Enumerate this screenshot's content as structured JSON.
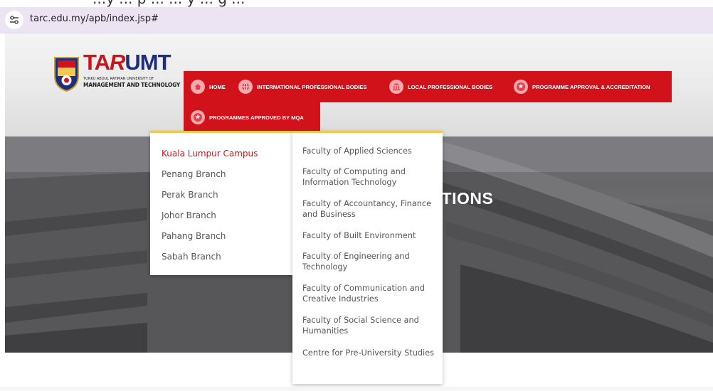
{
  "browser": {
    "top_text": "...y ... p ... ... y ... g ...",
    "url": "tarc.edu.my/apb/index.jsp#"
  },
  "logo": {
    "brand": {
      "ta": "TA",
      "r": "R",
      "umt": "UMT"
    },
    "subtitle_line1": "TUNKU ABDUL RAHMAN     UNIVERSITY OF",
    "subtitle_line2": "MANAGEMENT AND TECHNOLOGY"
  },
  "nav": {
    "items": [
      {
        "label": "HOME",
        "icon": "home-icon"
      },
      {
        "label": "INTERNATIONAL PROFESSIONAL BODIES",
        "icon": "globe-icon"
      },
      {
        "label": "LOCAL PROFESSIONAL BODIES",
        "icon": "institution-icon"
      },
      {
        "label": "PROGRAMME APPROVAL & ACCREDITATION",
        "icon": "star-icon"
      },
      {
        "label": "PROGRAMMES APPROVED BY MQA",
        "icon": "star-icon"
      }
    ]
  },
  "hero": {
    "title": "ACCREDITATIONS"
  },
  "campus_menu": {
    "items": [
      {
        "label": "Kuala Lumpur Campus",
        "active": true
      },
      {
        "label": "Penang Branch"
      },
      {
        "label": "Perak Branch"
      },
      {
        "label": "Johor Branch"
      },
      {
        "label": "Pahang Branch"
      },
      {
        "label": "Sabah Branch"
      }
    ]
  },
  "faculty_menu": {
    "items": [
      {
        "label": "Faculty of Applied Sciences"
      },
      {
        "label": "Faculty of Computing and Information Technology"
      },
      {
        "label": "Faculty of Accountancy, Finance and Business"
      },
      {
        "label": "Faculty of Built Environment"
      },
      {
        "label": "Faculty of Engineering and Technology"
      },
      {
        "label": "Faculty of Communication and Creative Industries"
      },
      {
        "label": "Faculty of Social Science and Humanities"
      },
      {
        "label": "Centre for Pre-University Studies"
      }
    ]
  },
  "colors": {
    "brand_red": "#d2121a",
    "brand_blue": "#1c2f7c",
    "dropdown_accent": "#f2c94c",
    "active_item": "#d2121a"
  }
}
